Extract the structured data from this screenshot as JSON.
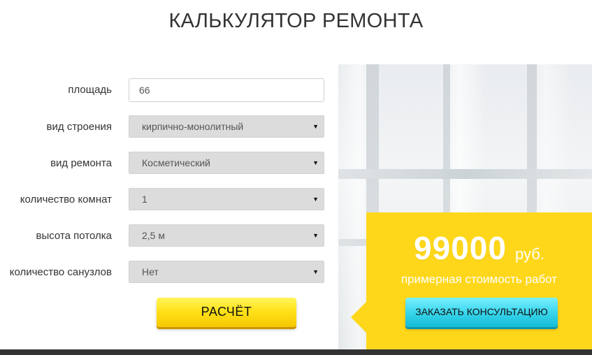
{
  "header": {
    "title": "КАЛЬКУЛЯТОР РЕМОНТА"
  },
  "form": {
    "area": {
      "label": "площадь",
      "value": "66"
    },
    "building_type": {
      "label": "вид строения",
      "value": "кирпично-монолитный"
    },
    "repair_type": {
      "label": "вид ремонта",
      "value": "Косметический"
    },
    "rooms": {
      "label": "количество комнат",
      "value": "1"
    },
    "ceiling_height": {
      "label": "высота потолка",
      "value": "2,5 м"
    },
    "bathrooms": {
      "label": "количество санузлов",
      "value": "Нет"
    },
    "calculate_label": "РАСЧЁТ"
  },
  "result": {
    "price": "99000",
    "currency": "руб.",
    "note": "примерная стоимость работ",
    "consult_label": "ЗАКАЗАТЬ КОНСУЛЬТАЦИЮ"
  },
  "icons": {
    "select_arrow": "▼"
  },
  "colors": {
    "accent_yellow": "#ffd71a",
    "button_yellow": "#ffe21a",
    "button_cyan": "#3ad6ec",
    "footer": "#333333"
  }
}
